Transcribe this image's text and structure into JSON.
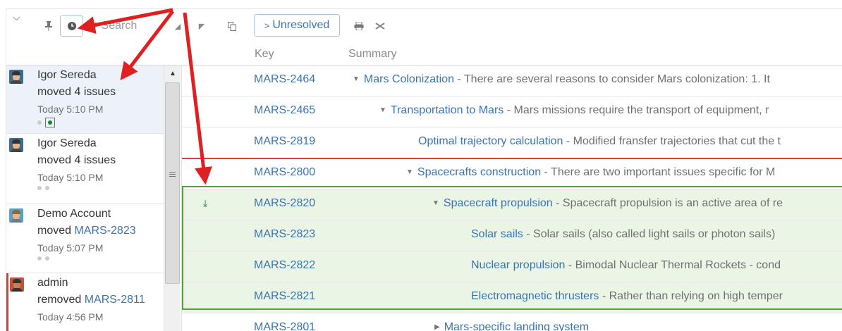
{
  "toolbar": {
    "search_placeholder": "Search",
    "unresolved_label": "Unresolved",
    "icons": [
      "collapse-chevron-icon",
      "pin-icon",
      "clock-icon",
      "search-icon",
      "triangle-up-icon",
      "triangle-down-icon",
      "copy-icon",
      "print-icon",
      "clear-icon"
    ]
  },
  "columns": {
    "key": "Key",
    "summary": "Summary"
  },
  "activity": [
    {
      "user": "Igor Sereda",
      "action": "moved 4 issues",
      "link": "",
      "time": "Today 5:10 PM",
      "selected": true
    },
    {
      "user": "Igor Sereda",
      "action": "moved 4 issues",
      "link": "",
      "time": "Today 5:10 PM",
      "selected": false
    },
    {
      "user": "Demo Account",
      "action": "moved ",
      "link": "MARS-2823",
      "time": "Today 5:07 PM",
      "selected": false
    },
    {
      "user": "admin",
      "action": "removed ",
      "link": "MARS-2811",
      "time": "Today 4:56 PM",
      "selected": false
    }
  ],
  "issues": [
    {
      "key": "MARS-2464",
      "title": "Mars Colonization",
      "desc": "There are several reasons to consider Mars colonization: 1. It",
      "expander": "expanded"
    },
    {
      "key": "MARS-2465",
      "title": "Transportation to Mars",
      "desc": "Mars missions require the transport of equipment, r",
      "expander": "expanded"
    },
    {
      "key": "MARS-2819",
      "title": "Optimal trajectory calculation",
      "desc": "Modified fransfer trajectories that cut the t",
      "expander": "none"
    },
    {
      "key": "MARS-2800",
      "title": "Spacecrafts construction",
      "desc": "There are two important issues specific for M",
      "expander": "expanded"
    },
    {
      "key": "MARS-2820",
      "title": "Spacecraft propulsion",
      "desc": "Spacecraft propulsion is an active area of re",
      "expander": "expanded"
    },
    {
      "key": "MARS-2823",
      "title": "Solar sails",
      "desc": "Solar sails (also called light sails or photon sails)",
      "expander": "none"
    },
    {
      "key": "MARS-2822",
      "title": "Nuclear propulsion",
      "desc": "Bimodal Nuclear Thermal Rockets - cond",
      "expander": "none"
    },
    {
      "key": "MARS-2821",
      "title": "Electromagnetic thrusters",
      "desc": "Rather than relying on high temper",
      "expander": "none"
    },
    {
      "key": "MARS-2801",
      "title": "Mars-specific landing system",
      "desc": "",
      "expander": "collapsed"
    }
  ],
  "colors": {
    "link": "#3b73af",
    "highlight_green": "#eaf5e6",
    "border_green": "#5a9e3a",
    "marker_red": "#d04437",
    "arrow_red": "#e02020"
  }
}
